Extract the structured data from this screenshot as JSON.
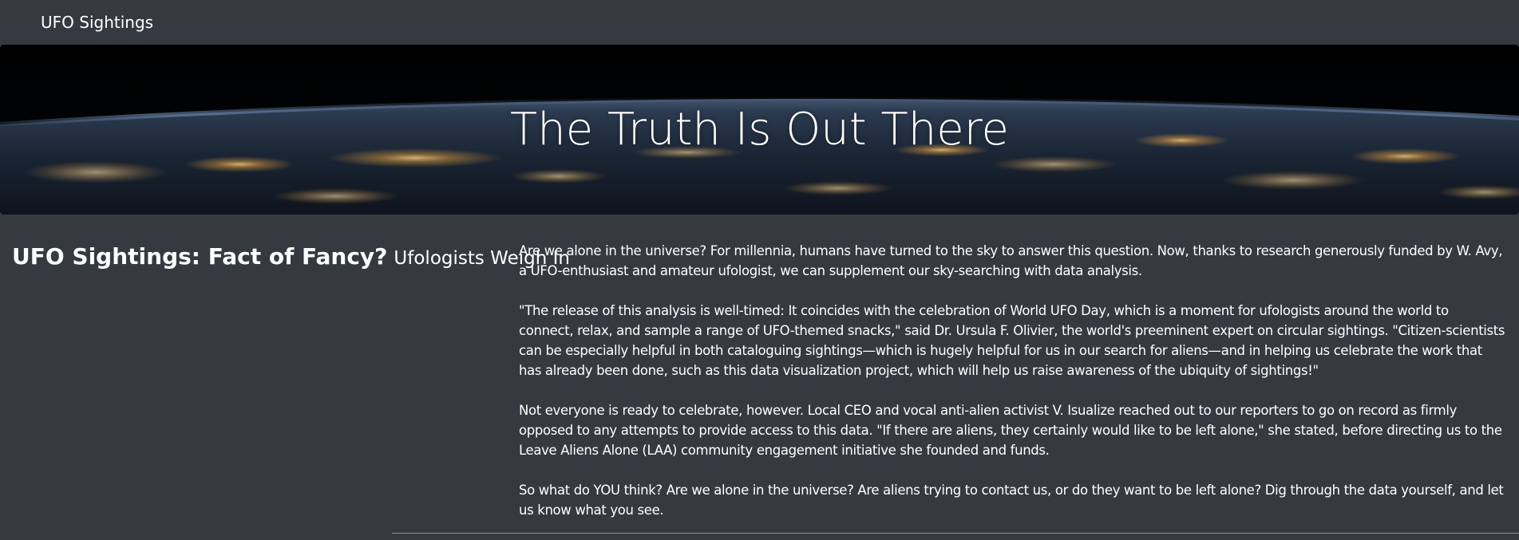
{
  "navbar": {
    "brand": "UFO Sightings"
  },
  "hero": {
    "title": "The Truth Is Out There"
  },
  "heading": {
    "main": "UFO Sightings: Fact of Fancy?",
    "sub": "Ufologists Weigh In"
  },
  "article": {
    "paragraphs": [
      "Are we alone in the universe? For millennia, humans have turned to the sky to answer this question. Now, thanks to research generously funded by W. Avy, a UFO-enthusiast and amateur ufologist, we can supplement our sky-searching with data analysis.",
      "\"The release of this analysis is well-timed: It coincides with the celebration of World UFO Day, which is a moment for ufologists around the world to connect, relax, and sample a range of UFO-themed snacks,\" said Dr. Ursula F. Olivier, the world's preeminent expert on circular sightings. \"Citizen-scientists can be especially helpful in both cataloguing sightings—which is hugely helpful for us in our search for aliens—and in helping us celebrate the work that has already been done, such as this data visualization project, which will help us raise awareness of the ubiquity of sightings!\"",
      "Not everyone is ready to celebrate, however. Local CEO and vocal anti-alien activist V. Isualize reached out to our reporters to go on record as firmly opposed to any attempts to provide access to this data. \"If there are aliens, they certainly would like to be left alone,\" she stated, before directing us to the Leave Aliens Alone (LAA) community engagement initiative she founded and funds.",
      "So what do YOU think? Are we alone in the universe? Are aliens trying to contact us, or do they want to be left alone? Dig through the data yourself, and let us know what you see."
    ]
  },
  "colors": {
    "background": "#343a40",
    "text": "#ffffff"
  }
}
